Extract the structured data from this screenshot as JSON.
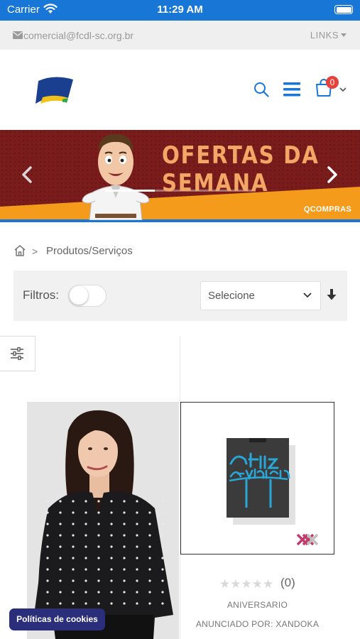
{
  "status_bar": {
    "carrier": "Carrier",
    "time": "11:29 AM",
    "battery_level": 1.0
  },
  "top_bar": {
    "email": "comercial@fcdl-sc.org.br",
    "links_label": "LINKS"
  },
  "header": {
    "cart_count": "0",
    "colors": {
      "accent": "#1877d6",
      "badge": "#e8403a"
    }
  },
  "banner": {
    "line1": "OFERTAS DA",
    "line2": "SEMANA",
    "brand": "QCOMPRAS",
    "slide_progress": 0.33,
    "colors": {
      "background": "#7a1c1c",
      "text": "#f2a766",
      "stripe": "#f49b1c"
    }
  },
  "breadcrumb": {
    "separator": ">",
    "current": "Produtos/Serviços"
  },
  "filters": {
    "label": "Filtros:",
    "toggle_on": false,
    "sort_value": "Selecione"
  },
  "products": [
    {
      "type": "photo",
      "subject": "woman in black polka-dot blouse"
    },
    {
      "type": "listing",
      "rating": 0,
      "rating_max": 5,
      "review_count": "(0)",
      "name": "ANIVERSARIO",
      "seller": "ANUNCIADO POR: XANDOKA",
      "product_text": "Feliz Aniversário"
    }
  ],
  "cookie_button": {
    "label": "Políticas de cookies"
  }
}
